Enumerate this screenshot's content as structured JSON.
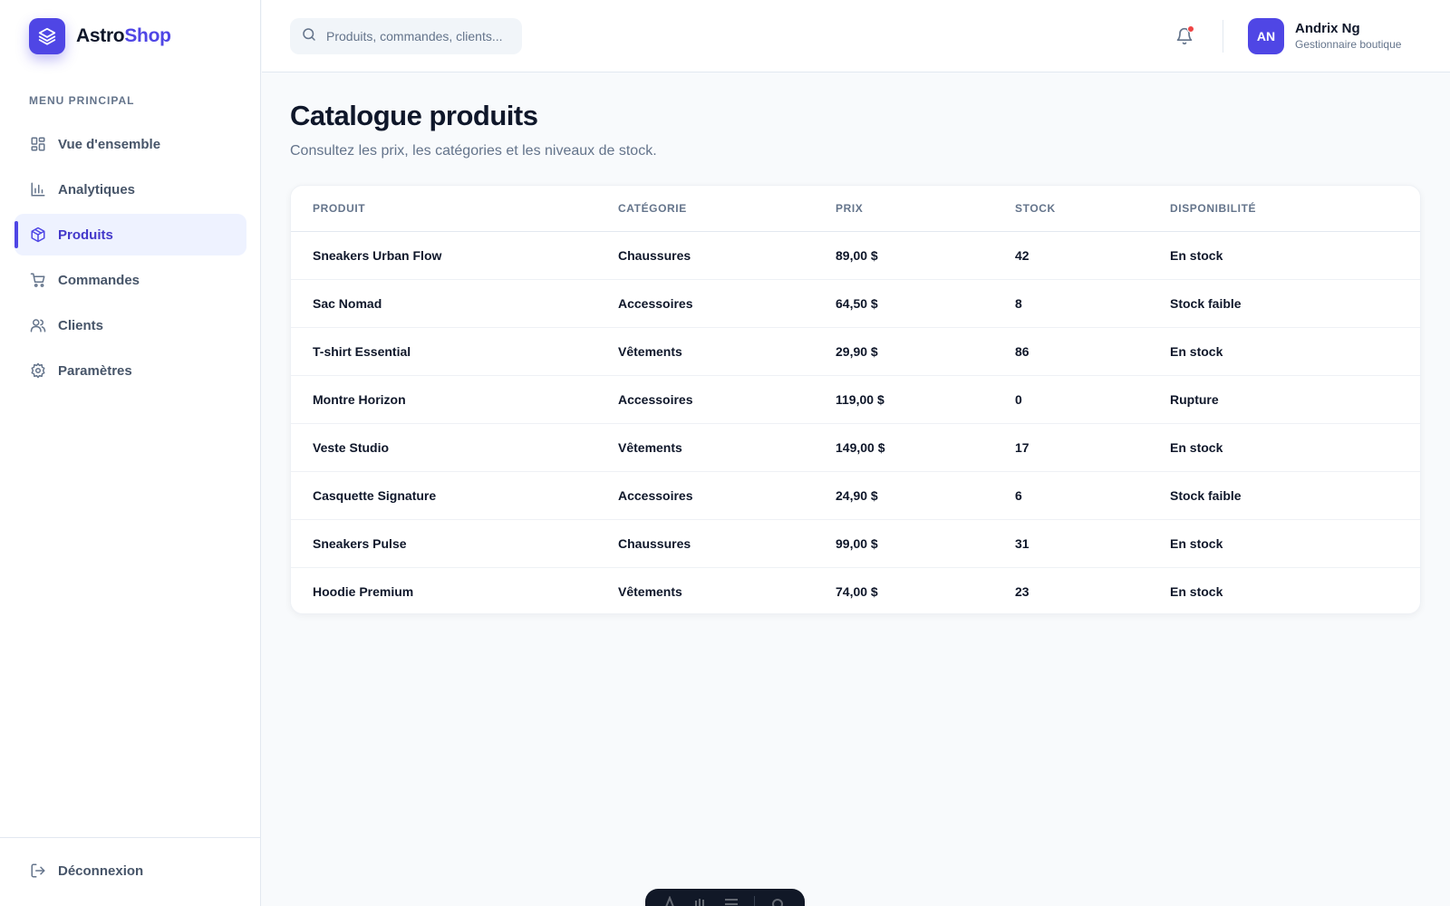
{
  "brand": {
    "name_prefix": "Astro",
    "name_accent": "Shop"
  },
  "sidebar": {
    "section_title": "MENU PRINCIPAL",
    "items": [
      {
        "label": "Vue d'ensemble",
        "icon": "grid-icon",
        "active": false
      },
      {
        "label": "Analytiques",
        "icon": "bar-chart-icon",
        "active": false
      },
      {
        "label": "Produits",
        "icon": "box-icon",
        "active": true
      },
      {
        "label": "Commandes",
        "icon": "cart-icon",
        "active": false
      },
      {
        "label": "Clients",
        "icon": "users-icon",
        "active": false
      },
      {
        "label": "Paramètres",
        "icon": "gear-icon",
        "active": false
      }
    ],
    "logout_label": "Déconnexion"
  },
  "header": {
    "search_placeholder": "Produits, commandes, clients...",
    "user": {
      "initials": "AN",
      "name": "Andrix Ng",
      "role": "Gestionnaire boutique"
    }
  },
  "page": {
    "title": "Catalogue produits",
    "subtitle": "Consultez les prix, les catégories et les niveaux de stock."
  },
  "table": {
    "columns": [
      "PRODUIT",
      "CATÉGORIE",
      "PRIX",
      "STOCK",
      "DISPONIBILITÉ"
    ],
    "rows": [
      [
        "Sneakers Urban Flow",
        "Chaussures",
        "89,00 $",
        "42",
        "En stock"
      ],
      [
        "Sac Nomad",
        "Accessoires",
        "64,50 $",
        "8",
        "Stock faible"
      ],
      [
        "T-shirt Essential",
        "Vêtements",
        "29,90 $",
        "86",
        "En stock"
      ],
      [
        "Montre Horizon",
        "Accessoires",
        "119,00 $",
        "0",
        "Rupture"
      ],
      [
        "Veste Studio",
        "Vêtements",
        "149,00 $",
        "17",
        "En stock"
      ],
      [
        "Casquette Signature",
        "Accessoires",
        "24,90 $",
        "6",
        "Stock faible"
      ],
      [
        "Sneakers Pulse",
        "Chaussures",
        "99,00 $",
        "31",
        "En stock"
      ],
      [
        "Hoodie Premium",
        "Vêtements",
        "74,00 $",
        "23",
        "En stock"
      ]
    ]
  },
  "colors": {
    "accent": "#4f46e5",
    "notification": "#ef4444"
  }
}
